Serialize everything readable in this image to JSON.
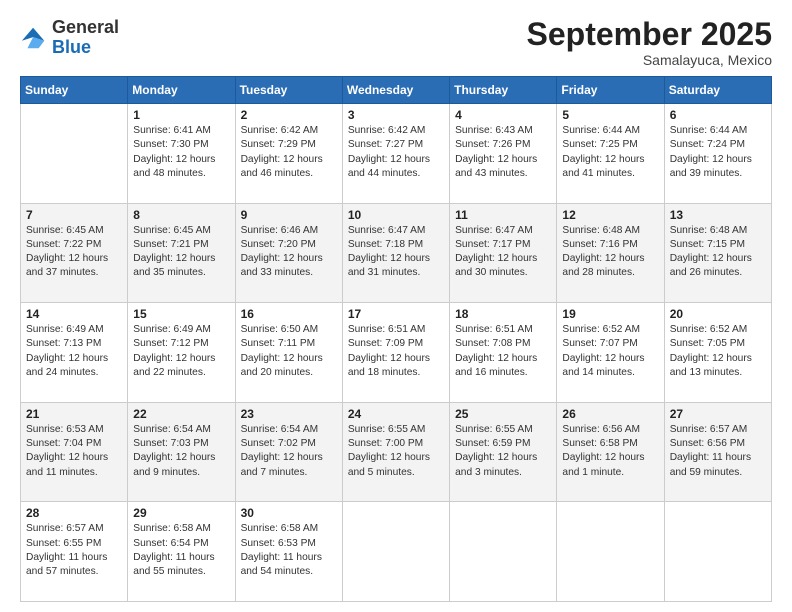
{
  "header": {
    "logo_general": "General",
    "logo_blue": "Blue",
    "month_title": "September 2025",
    "location": "Samalayuca, Mexico"
  },
  "weekdays": [
    "Sunday",
    "Monday",
    "Tuesday",
    "Wednesday",
    "Thursday",
    "Friday",
    "Saturday"
  ],
  "weeks": [
    [
      {
        "day": "",
        "sunrise": "",
        "sunset": "",
        "daylight": ""
      },
      {
        "day": "1",
        "sunrise": "Sunrise: 6:41 AM",
        "sunset": "Sunset: 7:30 PM",
        "daylight": "Daylight: 12 hours and 48 minutes."
      },
      {
        "day": "2",
        "sunrise": "Sunrise: 6:42 AM",
        "sunset": "Sunset: 7:29 PM",
        "daylight": "Daylight: 12 hours and 46 minutes."
      },
      {
        "day": "3",
        "sunrise": "Sunrise: 6:42 AM",
        "sunset": "Sunset: 7:27 PM",
        "daylight": "Daylight: 12 hours and 44 minutes."
      },
      {
        "day": "4",
        "sunrise": "Sunrise: 6:43 AM",
        "sunset": "Sunset: 7:26 PM",
        "daylight": "Daylight: 12 hours and 43 minutes."
      },
      {
        "day": "5",
        "sunrise": "Sunrise: 6:44 AM",
        "sunset": "Sunset: 7:25 PM",
        "daylight": "Daylight: 12 hours and 41 minutes."
      },
      {
        "day": "6",
        "sunrise": "Sunrise: 6:44 AM",
        "sunset": "Sunset: 7:24 PM",
        "daylight": "Daylight: 12 hours and 39 minutes."
      }
    ],
    [
      {
        "day": "7",
        "sunrise": "Sunrise: 6:45 AM",
        "sunset": "Sunset: 7:22 PM",
        "daylight": "Daylight: 12 hours and 37 minutes."
      },
      {
        "day": "8",
        "sunrise": "Sunrise: 6:45 AM",
        "sunset": "Sunset: 7:21 PM",
        "daylight": "Daylight: 12 hours and 35 minutes."
      },
      {
        "day": "9",
        "sunrise": "Sunrise: 6:46 AM",
        "sunset": "Sunset: 7:20 PM",
        "daylight": "Daylight: 12 hours and 33 minutes."
      },
      {
        "day": "10",
        "sunrise": "Sunrise: 6:47 AM",
        "sunset": "Sunset: 7:18 PM",
        "daylight": "Daylight: 12 hours and 31 minutes."
      },
      {
        "day": "11",
        "sunrise": "Sunrise: 6:47 AM",
        "sunset": "Sunset: 7:17 PM",
        "daylight": "Daylight: 12 hours and 30 minutes."
      },
      {
        "day": "12",
        "sunrise": "Sunrise: 6:48 AM",
        "sunset": "Sunset: 7:16 PM",
        "daylight": "Daylight: 12 hours and 28 minutes."
      },
      {
        "day": "13",
        "sunrise": "Sunrise: 6:48 AM",
        "sunset": "Sunset: 7:15 PM",
        "daylight": "Daylight: 12 hours and 26 minutes."
      }
    ],
    [
      {
        "day": "14",
        "sunrise": "Sunrise: 6:49 AM",
        "sunset": "Sunset: 7:13 PM",
        "daylight": "Daylight: 12 hours and 24 minutes."
      },
      {
        "day": "15",
        "sunrise": "Sunrise: 6:49 AM",
        "sunset": "Sunset: 7:12 PM",
        "daylight": "Daylight: 12 hours and 22 minutes."
      },
      {
        "day": "16",
        "sunrise": "Sunrise: 6:50 AM",
        "sunset": "Sunset: 7:11 PM",
        "daylight": "Daylight: 12 hours and 20 minutes."
      },
      {
        "day": "17",
        "sunrise": "Sunrise: 6:51 AM",
        "sunset": "Sunset: 7:09 PM",
        "daylight": "Daylight: 12 hours and 18 minutes."
      },
      {
        "day": "18",
        "sunrise": "Sunrise: 6:51 AM",
        "sunset": "Sunset: 7:08 PM",
        "daylight": "Daylight: 12 hours and 16 minutes."
      },
      {
        "day": "19",
        "sunrise": "Sunrise: 6:52 AM",
        "sunset": "Sunset: 7:07 PM",
        "daylight": "Daylight: 12 hours and 14 minutes."
      },
      {
        "day": "20",
        "sunrise": "Sunrise: 6:52 AM",
        "sunset": "Sunset: 7:05 PM",
        "daylight": "Daylight: 12 hours and 13 minutes."
      }
    ],
    [
      {
        "day": "21",
        "sunrise": "Sunrise: 6:53 AM",
        "sunset": "Sunset: 7:04 PM",
        "daylight": "Daylight: 12 hours and 11 minutes."
      },
      {
        "day": "22",
        "sunrise": "Sunrise: 6:54 AM",
        "sunset": "Sunset: 7:03 PM",
        "daylight": "Daylight: 12 hours and 9 minutes."
      },
      {
        "day": "23",
        "sunrise": "Sunrise: 6:54 AM",
        "sunset": "Sunset: 7:02 PM",
        "daylight": "Daylight: 12 hours and 7 minutes."
      },
      {
        "day": "24",
        "sunrise": "Sunrise: 6:55 AM",
        "sunset": "Sunset: 7:00 PM",
        "daylight": "Daylight: 12 hours and 5 minutes."
      },
      {
        "day": "25",
        "sunrise": "Sunrise: 6:55 AM",
        "sunset": "Sunset: 6:59 PM",
        "daylight": "Daylight: 12 hours and 3 minutes."
      },
      {
        "day": "26",
        "sunrise": "Sunrise: 6:56 AM",
        "sunset": "Sunset: 6:58 PM",
        "daylight": "Daylight: 12 hours and 1 minute."
      },
      {
        "day": "27",
        "sunrise": "Sunrise: 6:57 AM",
        "sunset": "Sunset: 6:56 PM",
        "daylight": "Daylight: 11 hours and 59 minutes."
      }
    ],
    [
      {
        "day": "28",
        "sunrise": "Sunrise: 6:57 AM",
        "sunset": "Sunset: 6:55 PM",
        "daylight": "Daylight: 11 hours and 57 minutes."
      },
      {
        "day": "29",
        "sunrise": "Sunrise: 6:58 AM",
        "sunset": "Sunset: 6:54 PM",
        "daylight": "Daylight: 11 hours and 55 minutes."
      },
      {
        "day": "30",
        "sunrise": "Sunrise: 6:58 AM",
        "sunset": "Sunset: 6:53 PM",
        "daylight": "Daylight: 11 hours and 54 minutes."
      },
      {
        "day": "",
        "sunrise": "",
        "sunset": "",
        "daylight": ""
      },
      {
        "day": "",
        "sunrise": "",
        "sunset": "",
        "daylight": ""
      },
      {
        "day": "",
        "sunrise": "",
        "sunset": "",
        "daylight": ""
      },
      {
        "day": "",
        "sunrise": "",
        "sunset": "",
        "daylight": ""
      }
    ]
  ]
}
